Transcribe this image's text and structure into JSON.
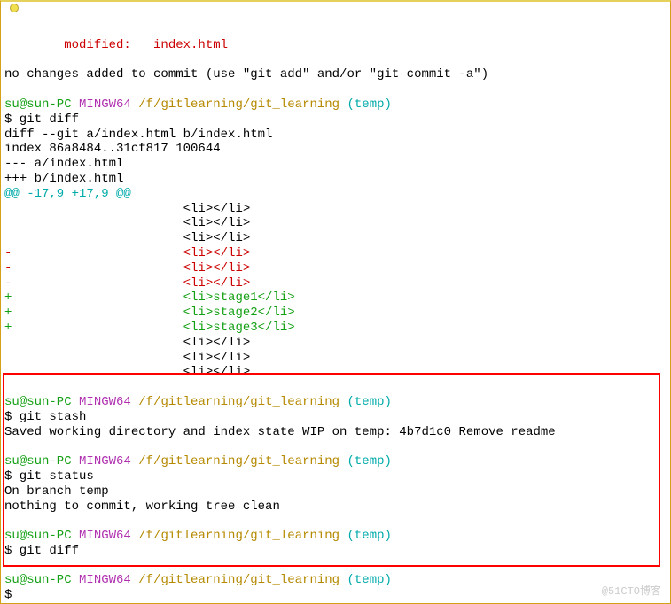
{
  "tab": {
    "title": ""
  },
  "lines": {
    "modified": "        modified:   index.html",
    "nochanges": "no changes added to commit (use \"git add\" and/or \"git commit -a\")",
    "prompt": {
      "user": "su@sun-PC",
      "host": " MINGW64",
      "path": " /f/gitlearning/git_learning",
      "branch": " (temp)"
    },
    "cmd_diff": "$ git diff",
    "diff_header1": "diff --git a/index.html b/index.html",
    "diff_header2": "index 86a8484..31cf817 100644",
    "diff_minus": "--- a/index.html",
    "diff_plus": "+++ b/index.html",
    "hunk": "@@ -17,9 +17,9 @@",
    "ctx_li": "                        <li></li>",
    "del1": "-                       <li></li>",
    "del2": "-                       <li></li>",
    "del3": "-                       <li></li>",
    "add1": "+                       <li>stage1</li>",
    "add2": "+                       <li>stage2</li>",
    "add3": "+                       <li>stage3</li>",
    "cmd_stash": "$ git stash",
    "stash_out": "Saved working directory and index state WIP on temp: 4b7d1c0 Remove readme",
    "cmd_status": "$ git status",
    "status_out1": "On branch temp",
    "status_out2": "nothing to commit, working tree clean",
    "cmd_diff2": "$ git diff",
    "prompt_dollar": "$",
    "watermark": "@51CTO博客"
  }
}
